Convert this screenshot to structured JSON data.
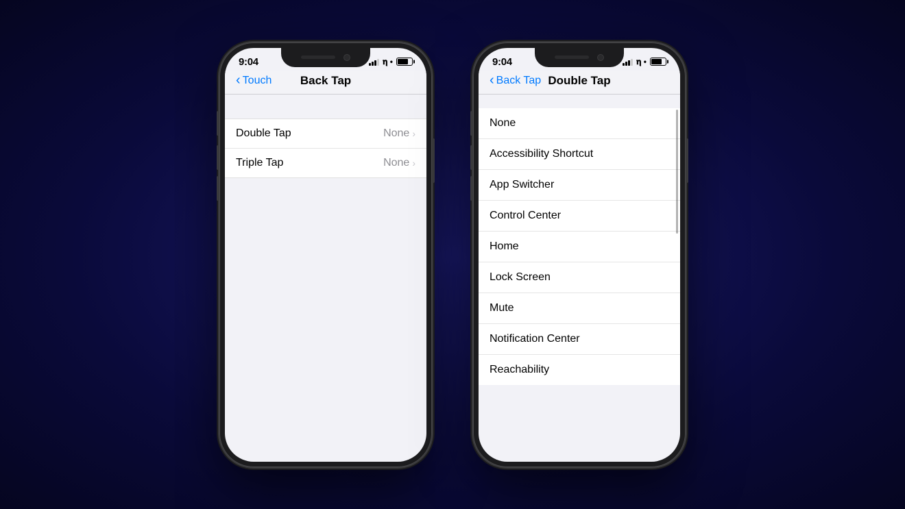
{
  "background": "#0a0a3a",
  "accent_color": "#007aff",
  "phone1": {
    "status_time": "9:04",
    "nav_back_label": "Touch",
    "nav_title": "Back Tap",
    "settings_items": [
      {
        "label": "Double Tap",
        "value": "None"
      },
      {
        "label": "Triple Tap",
        "value": "None"
      }
    ]
  },
  "phone2": {
    "status_time": "9:04",
    "nav_back_label": "Back Tap",
    "nav_title": "Double Tap",
    "options": [
      "None",
      "Accessibility Shortcut",
      "App Switcher",
      "Control Center",
      "Home",
      "Lock Screen",
      "Mute",
      "Notification Center",
      "Reachability"
    ]
  },
  "icons": {
    "back_chevron": "❮",
    "chevron_right": "›",
    "location_arrow": "➤"
  }
}
